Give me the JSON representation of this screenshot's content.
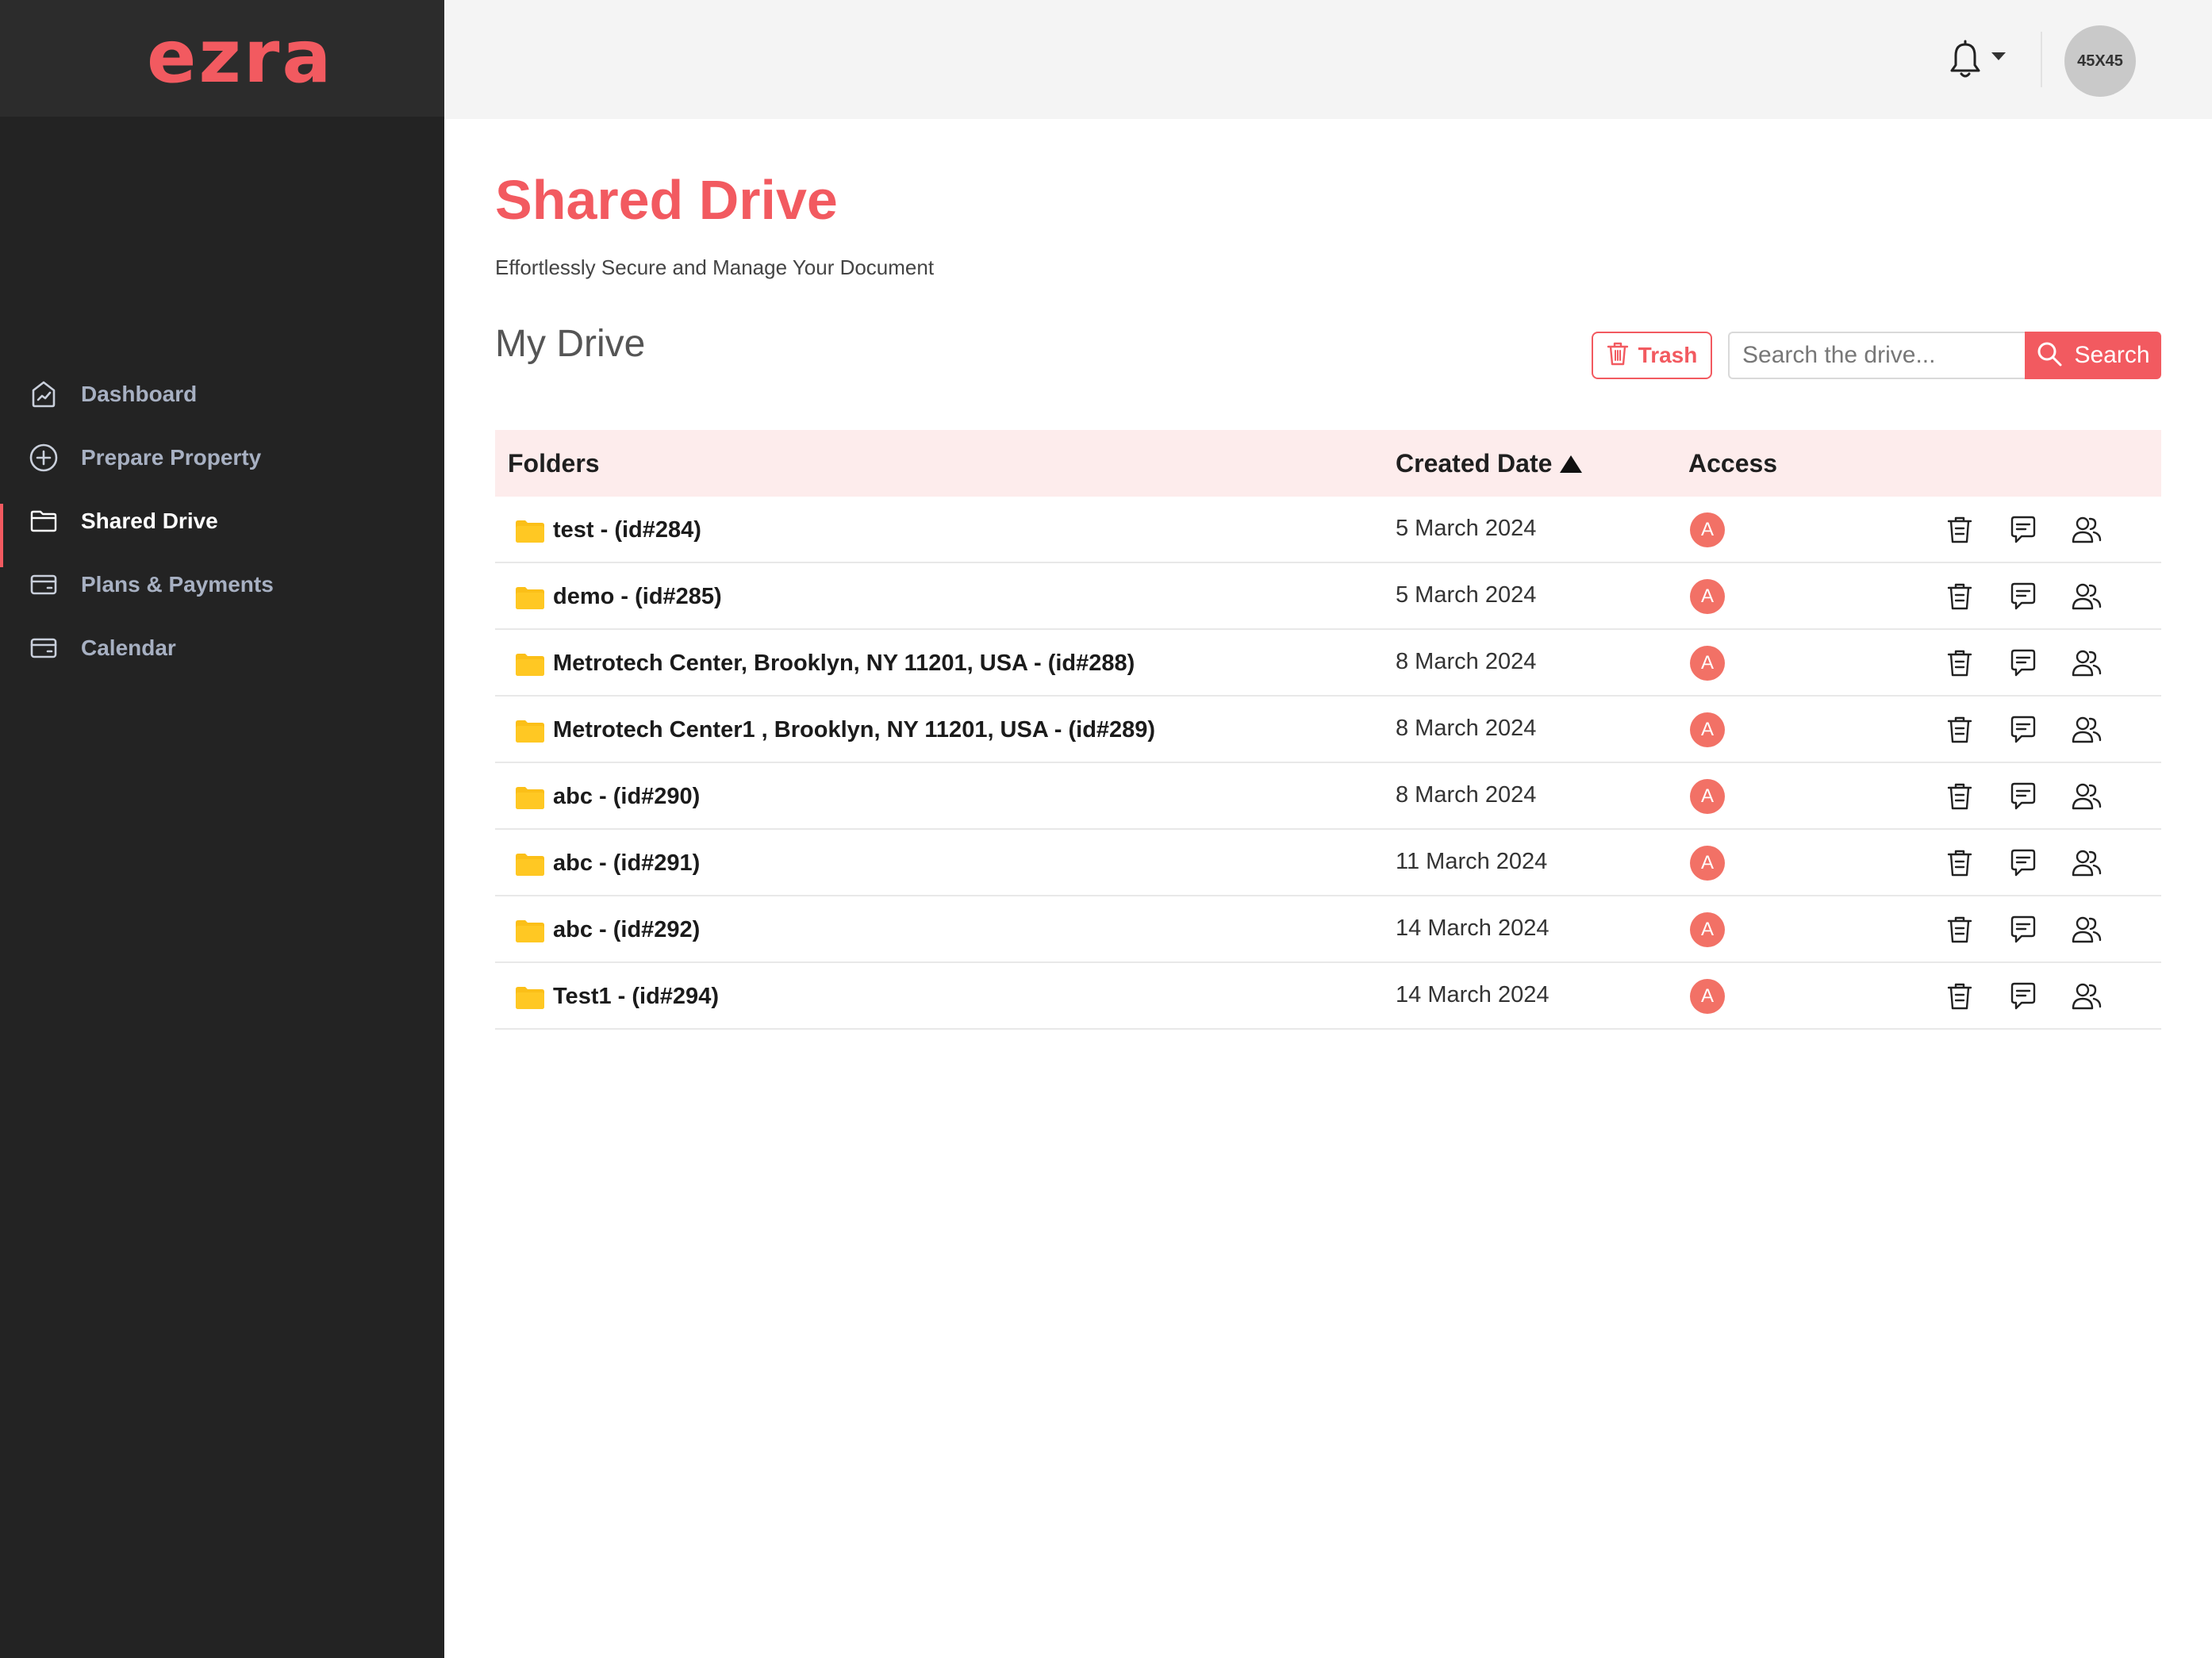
{
  "brand": {
    "logo_text": "ezra",
    "accent_color": "#f25a60"
  },
  "sidebar": {
    "items": [
      {
        "label": "Dashboard",
        "icon": "dashboard-icon",
        "active": false
      },
      {
        "label": "Prepare Property",
        "icon": "plus-circle-icon",
        "active": false
      },
      {
        "label": "Shared Drive",
        "icon": "folder-icon",
        "active": true
      },
      {
        "label": "Plans & Payments",
        "icon": "card-icon",
        "active": false
      },
      {
        "label": "Calendar",
        "icon": "card-icon",
        "active": false
      }
    ]
  },
  "header": {
    "avatar_text": "45X45",
    "notification_icon": "bell-icon"
  },
  "main": {
    "title": "Shared Drive",
    "subtitle": "Effortlessly Secure and Manage Your Document",
    "section_title": "My Drive",
    "trash_label": "Trash",
    "search_placeholder": "Search the drive...",
    "search_label": "Search"
  },
  "table": {
    "headers": {
      "folders": "Folders",
      "created": "Created Date",
      "access": "Access"
    },
    "rows": [
      {
        "name": "test - (id#284)",
        "date": "5 March 2024",
        "access": "A"
      },
      {
        "name": "demo - (id#285)",
        "date": "5 March 2024",
        "access": "A"
      },
      {
        "name": "Metrotech Center, Brooklyn, NY 11201, USA - (id#288)",
        "date": "8 March 2024",
        "access": "A"
      },
      {
        "name": "Metrotech Center1 , Brooklyn, NY 11201, USA - (id#289)",
        "date": "8 March 2024",
        "access": "A"
      },
      {
        "name": "abc - (id#290)",
        "date": "8 March 2024",
        "access": "A"
      },
      {
        "name": "abc - (id#291)",
        "date": "11 March 2024",
        "access": "A"
      },
      {
        "name": "abc - (id#292)",
        "date": "14 March 2024",
        "access": "A"
      },
      {
        "name": "Test1 - (id#294)",
        "date": "14 March 2024",
        "access": "A"
      }
    ]
  }
}
